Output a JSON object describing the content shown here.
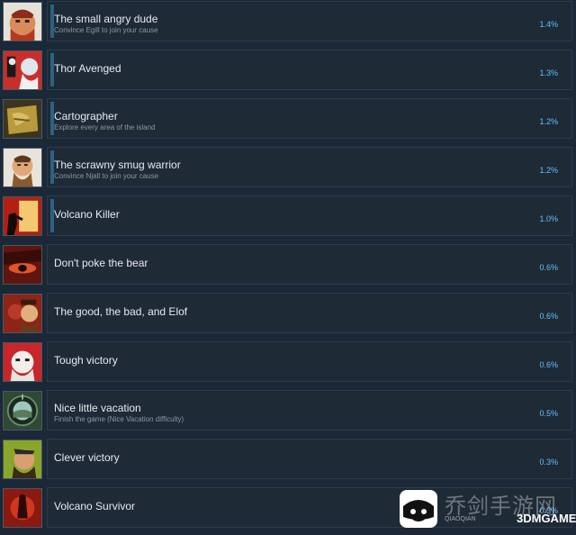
{
  "achievements": [
    {
      "title": "The small angry dude",
      "desc": "Convince Egill to join your cause",
      "pct": "1.4%"
    },
    {
      "title": "Thor Avenged",
      "desc": "",
      "pct": "1.3%"
    },
    {
      "title": "Cartographer",
      "desc": "Explore every area of the island",
      "pct": "1.2%"
    },
    {
      "title": "The scrawny smug warrior",
      "desc": "Convince Njall to join your cause",
      "pct": "1.2%"
    },
    {
      "title": "Volcano Killer",
      "desc": "",
      "pct": "1.0%"
    },
    {
      "title": "Don't poke the bear",
      "desc": "",
      "pct": "0.6%"
    },
    {
      "title": "The good, the bad, and Elof",
      "desc": "",
      "pct": "0.6%"
    },
    {
      "title": "Tough victory",
      "desc": "",
      "pct": "0.6%"
    },
    {
      "title": "Nice little vacation",
      "desc": "Finish the game (Nice Vacation difficulty)",
      "pct": "0.5%"
    },
    {
      "title": "Clever victory",
      "desc": "",
      "pct": "0.3%"
    },
    {
      "title": "Volcano Survivor",
      "desc": "",
      "pct": "0.3%"
    }
  ],
  "icons": [
    "angry-dwarf-portrait-icon",
    "thor-portrait-icon",
    "treasure-map-icon",
    "warrior-portrait-icon",
    "volcano-silhouette-icon",
    "bear-eye-icon",
    "two-vikings-portrait-icon",
    "tough-warrior-portrait-icon",
    "compass-scope-icon",
    "clever-warrior-portrait-icon",
    "volcano-figure-icon"
  ],
  "watermark": {
    "cn": "乔剑手游网",
    "en": "QIAOQIAN",
    "brand": "3DMGAME"
  }
}
